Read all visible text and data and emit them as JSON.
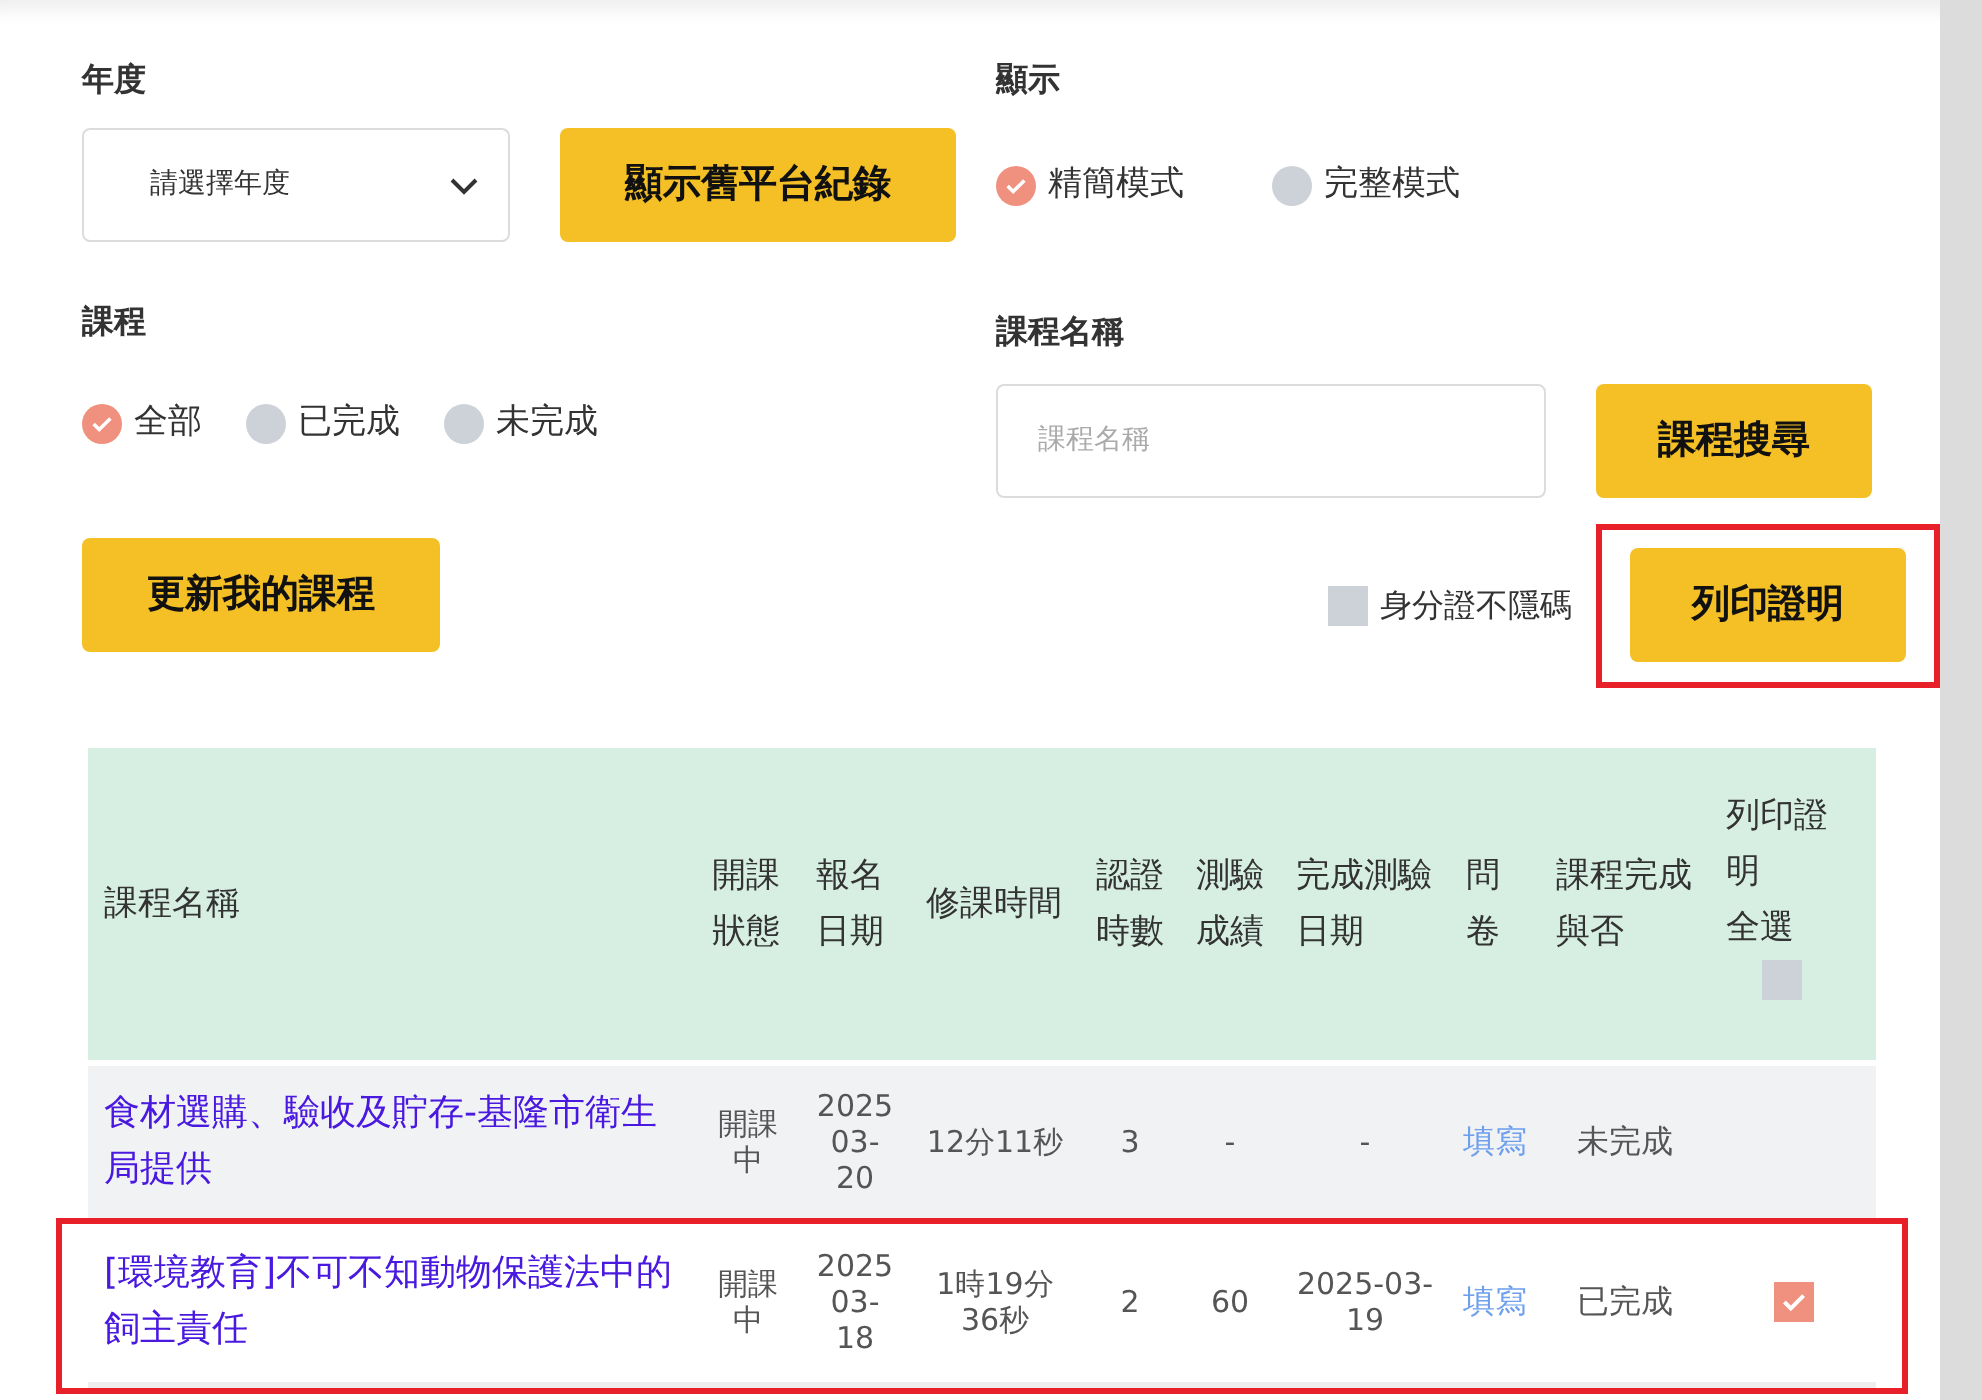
{
  "year": {
    "label": "年度",
    "placeholder": "請選擇年度"
  },
  "old_records_button": "顯示舊平台紀錄",
  "display": {
    "label": "顯示",
    "options": [
      {
        "label": "精簡模式",
        "selected": true
      },
      {
        "label": "完整模式",
        "selected": false
      }
    ]
  },
  "course_filter": {
    "label": "課程",
    "options": [
      {
        "label": "全部",
        "selected": true
      },
      {
        "label": "已完成",
        "selected": false
      },
      {
        "label": "未完成",
        "selected": false
      }
    ]
  },
  "course_name": {
    "label": "課程名稱",
    "placeholder": "課程名稱"
  },
  "search_button": "課程搜尋",
  "update_button": "更新我的課程",
  "show_id": {
    "label": "身分證不隱碼",
    "checked": false
  },
  "print_button": {
    "label": "列印證明",
    "highlighted": true
  },
  "table": {
    "columns": [
      "課程名稱",
      "開課狀態",
      "報名日期",
      "修課時間",
      "認證時數",
      "測驗成績",
      "完成測驗日期",
      "問卷",
      "課程完成與否"
    ],
    "print_column": {
      "label": "列印證明",
      "select_all": "全選",
      "checked": false
    },
    "rows": [
      {
        "name": "食材選購、驗收及貯存-基隆市衛生局提供",
        "status": "開課中",
        "registered": "2025 03-20",
        "duration": "12分11秒",
        "hours": "3",
        "score": "-",
        "completed_on": "-",
        "survey": "填寫",
        "result": "未完成",
        "highlighted": false
      },
      {
        "name": "[環境教育]不可不知動物保護法中的飼主責任",
        "status": "開課中",
        "registered": "2025 03-18",
        "duration": "1時19分36秒",
        "hours": "2",
        "score": "60",
        "completed_on": "2025-03-19",
        "survey": "填寫",
        "result": "已完成",
        "checked": true,
        "highlighted": true
      }
    ]
  }
}
